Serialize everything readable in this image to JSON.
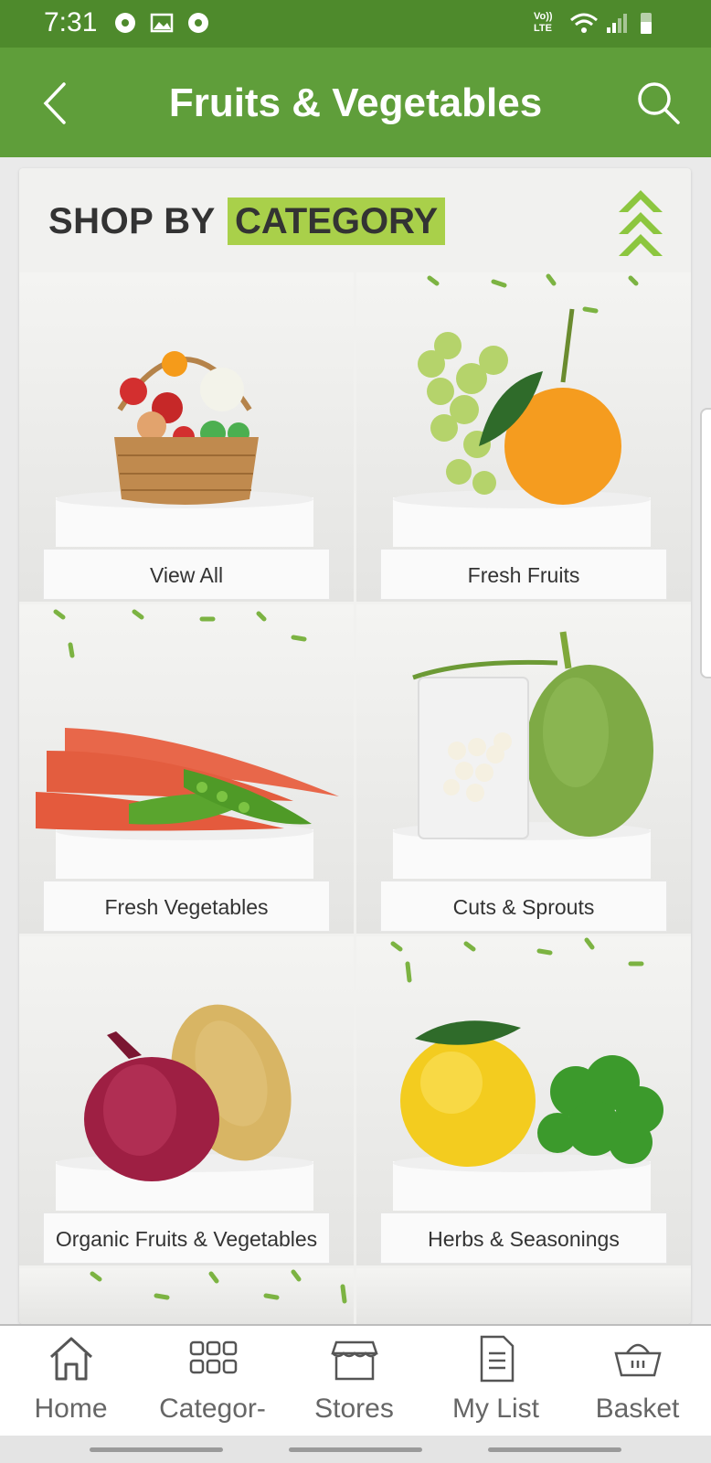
{
  "status_bar": {
    "time": "7:31",
    "network": "Vo)) LTE"
  },
  "app_bar": {
    "title": "Fruits & Vegetables"
  },
  "section": {
    "title_prefix": "SHOP BY",
    "title_highlight": "CATEGORY"
  },
  "categories": [
    {
      "label": "View All"
    },
    {
      "label": "Fresh Fruits"
    },
    {
      "label": "Fresh Vegetables"
    },
    {
      "label": "Cuts & Sprouts"
    },
    {
      "label": "Organic Fruits & Vegetables"
    },
    {
      "label": "Herbs & Seasonings"
    }
  ],
  "bottom_nav": [
    {
      "label": "Home",
      "icon": "home-icon"
    },
    {
      "label": "Categor-",
      "icon": "categories-grid-icon"
    },
    {
      "label": "Stores",
      "icon": "store-icon"
    },
    {
      "label": "My List",
      "icon": "list-icon"
    },
    {
      "label": "Basket",
      "icon": "basket-icon"
    }
  ],
  "colors": {
    "status_bar": "#4e8a2c",
    "app_bar": "#5f9e3a",
    "highlight": "#a9d04a"
  }
}
